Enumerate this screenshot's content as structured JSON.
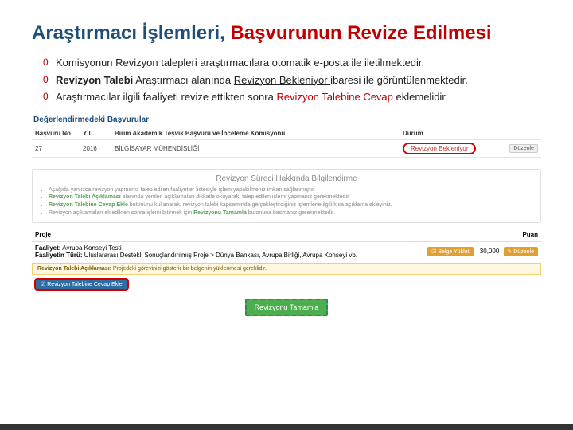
{
  "heading": {
    "part1": "Araştırmacı İşlemleri, ",
    "part2": "Başvurunun Revize Edilmesi"
  },
  "bullets": [
    {
      "pre": "Komisyonun Revizyon talepleri araştırmacılara otomatik e-posta ile iletilmektedir."
    },
    {
      "pre": "",
      "bold1": "Revizyon Talebi",
      "mid": " Araştırmacı alanında ",
      "under": "Revizyon Bekleniyor ",
      "post": "ibaresi ile görüntülenmektedir."
    },
    {
      "pre": "Araştırmacılar ilgili faaliyeti revize ettikten sonra ",
      "highlight": "Revizyon Talebine Cevap",
      "post2": " eklemelidir."
    }
  ],
  "panel": {
    "title": "Değerlendirmedeki Başvurular",
    "head": {
      "no": "Başvuru No",
      "yil": "Yıl",
      "kom": "Birim Akademik Teşvik Başvuru ve İnceleme Komisyonu",
      "durum": "Durum"
    },
    "row": {
      "no": "27",
      "yil": "2016",
      "kom": "BİLGİSAYAR MÜHENDİSLİĞİ",
      "durum": "Revizyon Bekleniyor",
      "edit": "Düzenle"
    }
  },
  "info": {
    "title": "Revizyon Süreci Hakkında Bilgilendirme",
    "items": [
      {
        "text": "Aşağıda yanlızca revizyon yapmanız talep edilen faaliyetler listesiyle işlem yapabilmeniz imkan sağlanmıştır."
      },
      {
        "bold": "Revizyon Talebi Açıklaması",
        "rest": " alanında yenilen açıklamaları dikkatle okuyarak, talep edilen işlemi yapmanız gerekmektedir."
      },
      {
        "bold": "Revizyon Talebine Cevap Ekle",
        "rest": " butonunu kullanarak, revizyon talebi kapsamında gerçekleştirdiğiniz işlemlerle ilgili kısa açıklama ekleyiniz."
      },
      {
        "text": "Revizyon açıklamaları ekledikten sonra işlemi bitirmek için ",
        "bold": "Revizyonu Tamamla",
        "rest2": " butonuna basmanız gerekmektedir."
      }
    ]
  },
  "project": {
    "head_left": "Proje",
    "head_right": "Puan",
    "faaliyet_label": "Faaliyet:",
    "faaliyet_value": " Avrupa Konseyi Testi",
    "turu_label": "Faaliyetin Türü:",
    "turu_value": " Uluslararası Destekli Sonuçlandırılmış Proje > Dünya Bankası, Avrupa Birliği, Avrupa Konseyi vb.",
    "puan": "30,000",
    "btn_belge": "☑ Belge Yüklet",
    "btn_duzenle": "✎ Düzenle"
  },
  "revdesc": {
    "label": "Revizyon Talebi Açıklaması:",
    "text": " Projedeki görevinizi gösterir bir belgenin yüklenmesi gereklidir."
  },
  "buttons": {
    "cevap": "☑ Revizyon Talebine Cevap Ekle",
    "complete": "Revizyonu Tamamla"
  }
}
